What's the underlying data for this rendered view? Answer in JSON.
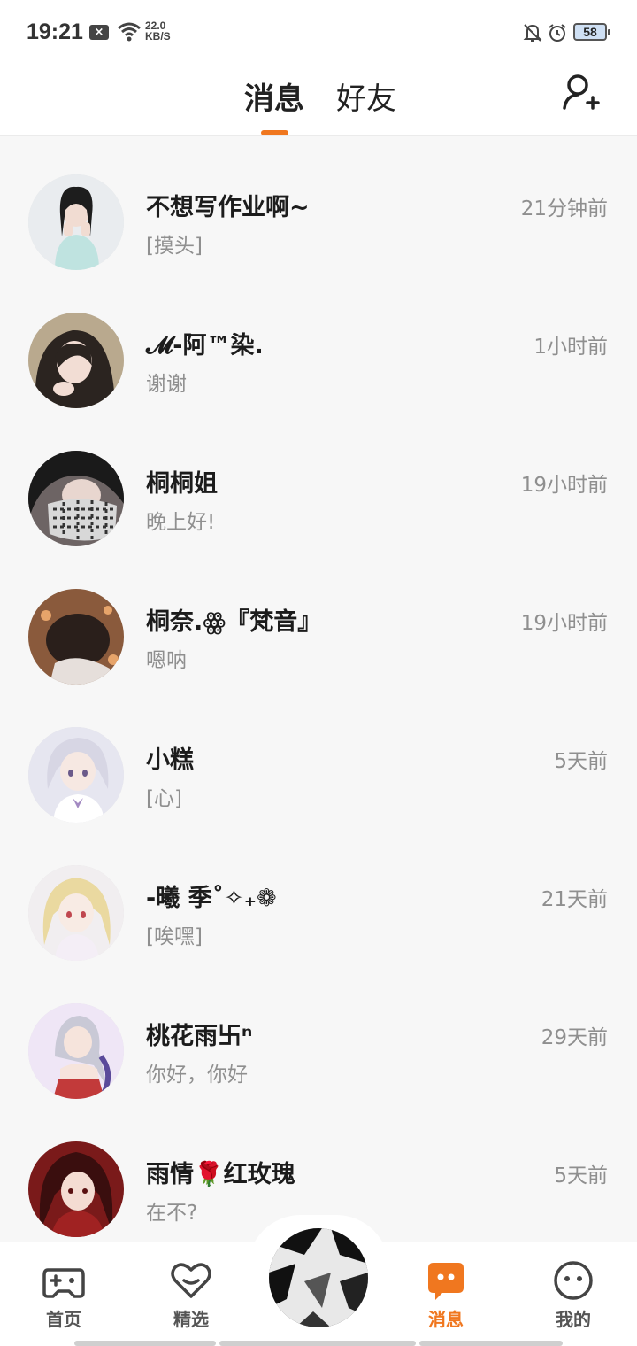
{
  "status_bar": {
    "time": "19:21",
    "network_speed_value": "22.0",
    "network_speed_unit": "KB/S",
    "battery": "58",
    "icons": [
      "close-box-icon",
      "wifi-icon",
      "bell-off-icon",
      "alarm-icon",
      "battery-icon"
    ]
  },
  "header": {
    "tabs": [
      {
        "label": "消息",
        "active": true
      },
      {
        "label": "好友",
        "active": false
      }
    ],
    "add_friend_icon": "add-user-icon",
    "accent_color": "#f0771f"
  },
  "conversations": [
    {
      "name": "不想写作业啊~",
      "preview": "[摸头]",
      "time": "21分钟前"
    },
    {
      "name": "𝓜-阿™染.",
      "preview": "谢谢",
      "time": "1小时前"
    },
    {
      "name": "桐桐姐",
      "preview": "晚上好!",
      "time": "19小时前"
    },
    {
      "name": "桐奈.ꙮ『梵音』",
      "preview": "嗯呐",
      "time": "19小时前"
    },
    {
      "name": "小糕",
      "preview": "[心]",
      "time": "5天前"
    },
    {
      "name": "-曦 季˚✧₊❁",
      "preview": "[唉嘿]",
      "time": "21天前"
    },
    {
      "name": "桃花雨卐ⁿ",
      "preview": "你好，你好",
      "time": "29天前"
    },
    {
      "name": "雨情🌹红玫瑰",
      "preview": "在不?",
      "time": "5天前"
    }
  ],
  "bottom_nav": {
    "items": [
      {
        "label": "首页",
        "icon": "gamepad-icon",
        "active": false
      },
      {
        "label": "精选",
        "icon": "heart-icon",
        "active": false
      },
      {
        "label": "消息",
        "icon": "chat-bubble-icon",
        "active": true
      },
      {
        "label": "我的",
        "icon": "smiley-face-icon",
        "active": false
      }
    ],
    "center_icon": "center-avatar"
  }
}
